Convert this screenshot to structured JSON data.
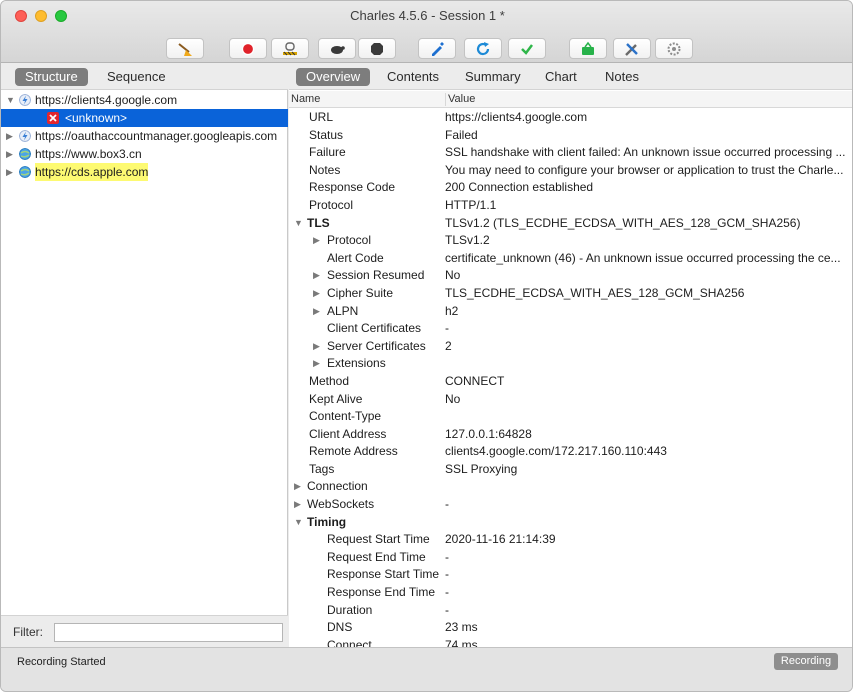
{
  "window": {
    "title": "Charles 4.5.6 - Session 1 *"
  },
  "toolbar": {
    "buttons": [
      {
        "icon": "broom-icon"
      },
      {
        "icon": "record-icon"
      },
      {
        "icon": "throttle-icon"
      },
      {
        "icon": "turtle-icon"
      },
      {
        "icon": "stop-icon"
      },
      {
        "icon": "pen-icon"
      },
      {
        "icon": "refresh-icon"
      },
      {
        "icon": "checkmark-icon"
      },
      {
        "icon": "basket-icon"
      },
      {
        "icon": "tools-icon"
      },
      {
        "icon": "settings-icon"
      }
    ],
    "colors": {
      "record": "#e0222a",
      "refresh": "#1d8ad6",
      "check": "#2fb64a",
      "basket": "#27b24a"
    }
  },
  "left": {
    "tabs": [
      {
        "label": "Structure",
        "active": true
      },
      {
        "label": "Sequence",
        "active": false
      }
    ],
    "tree": [
      {
        "label": "https://clients4.google.com",
        "icon": "lightning-icon",
        "expanded": true,
        "indent": 0
      },
      {
        "label": "<unknown>",
        "icon": "error-icon",
        "indent": 1,
        "selected": true
      },
      {
        "label": "https://oauthaccountmanager.googleapis.com",
        "icon": "lightning-icon",
        "expanded": false,
        "indent": 0
      },
      {
        "label": "https://www.box3.cn",
        "icon": "globe-icon",
        "expanded": false,
        "indent": 0
      },
      {
        "label": "https://cds.apple.com",
        "icon": "globe-icon",
        "expanded": false,
        "indent": 0,
        "highlighted": true
      }
    ],
    "filter": {
      "label": "Filter:",
      "value": ""
    }
  },
  "right": {
    "tabs": [
      {
        "label": "Overview",
        "active": true
      },
      {
        "label": "Contents",
        "active": false
      },
      {
        "label": "Summary",
        "active": false
      },
      {
        "label": "Chart",
        "active": false
      },
      {
        "label": "Notes",
        "active": false
      }
    ],
    "columns": {
      "name": "Name",
      "value": "Value"
    },
    "rows": [
      {
        "name": "URL",
        "value": "https://clients4.google.com",
        "level": 1
      },
      {
        "name": "Status",
        "value": "Failed",
        "level": 1
      },
      {
        "name": "Failure",
        "value": "SSL handshake with client failed: An unknown issue occurred processing ...",
        "level": 1
      },
      {
        "name": "Notes",
        "value": "You may need to configure your browser or application to trust the Charle...",
        "level": 1
      },
      {
        "name": "Response Code",
        "value": "200 Connection established",
        "level": 1
      },
      {
        "name": "Protocol",
        "value": "HTTP/1.1",
        "level": 1
      },
      {
        "name": "TLS",
        "value": "TLSv1.2 (TLS_ECDHE_ECDSA_WITH_AES_128_GCM_SHA256)",
        "level": 0,
        "toggle": "open",
        "bold": true
      },
      {
        "name": "Protocol",
        "value": "TLSv1.2",
        "level": 2,
        "toggle": "closed"
      },
      {
        "name": "Alert Code",
        "value": "certificate_unknown (46) - An unknown issue occurred processing the ce...",
        "level": 2
      },
      {
        "name": "Session Resumed",
        "value": "No",
        "level": 2,
        "toggle": "closed"
      },
      {
        "name": "Cipher Suite",
        "value": "TLS_ECDHE_ECDSA_WITH_AES_128_GCM_SHA256",
        "level": 2,
        "toggle": "closed"
      },
      {
        "name": "ALPN",
        "value": "h2",
        "level": 2,
        "toggle": "closed"
      },
      {
        "name": "Client Certificates",
        "value": "-",
        "level": 2
      },
      {
        "name": "Server Certificates",
        "value": "2",
        "level": 2,
        "toggle": "closed"
      },
      {
        "name": "Extensions",
        "value": "",
        "level": 2,
        "toggle": "closed"
      },
      {
        "name": "Method",
        "value": "CONNECT",
        "level": 1
      },
      {
        "name": "Kept Alive",
        "value": "No",
        "level": 1
      },
      {
        "name": "Content-Type",
        "value": "",
        "level": 1
      },
      {
        "name": "Client Address",
        "value": "127.0.0.1:64828",
        "level": 1
      },
      {
        "name": "Remote Address",
        "value": "clients4.google.com/172.217.160.110:443",
        "level": 1
      },
      {
        "name": "Tags",
        "value": "SSL Proxying",
        "level": 1
      },
      {
        "name": "Connection",
        "value": "",
        "level": 0,
        "toggle": "closed"
      },
      {
        "name": "WebSockets",
        "value": "-",
        "level": 0,
        "toggle": "closed"
      },
      {
        "name": "Timing",
        "value": "",
        "level": 0,
        "toggle": "open",
        "bold": true
      },
      {
        "name": "Request Start Time",
        "value": "2020-11-16 21:14:39",
        "level": 2
      },
      {
        "name": "Request End Time",
        "value": "-",
        "level": 2
      },
      {
        "name": "Response Start Time",
        "value": "-",
        "level": 2
      },
      {
        "name": "Response End Time",
        "value": "-",
        "level": 2
      },
      {
        "name": "Duration",
        "value": "-",
        "level": 2
      },
      {
        "name": "DNS",
        "value": "23 ms",
        "level": 2
      },
      {
        "name": "Connect",
        "value": "74 ms",
        "level": 2
      }
    ]
  },
  "statusbar": {
    "text": "Recording Started",
    "badge": "Recording"
  }
}
